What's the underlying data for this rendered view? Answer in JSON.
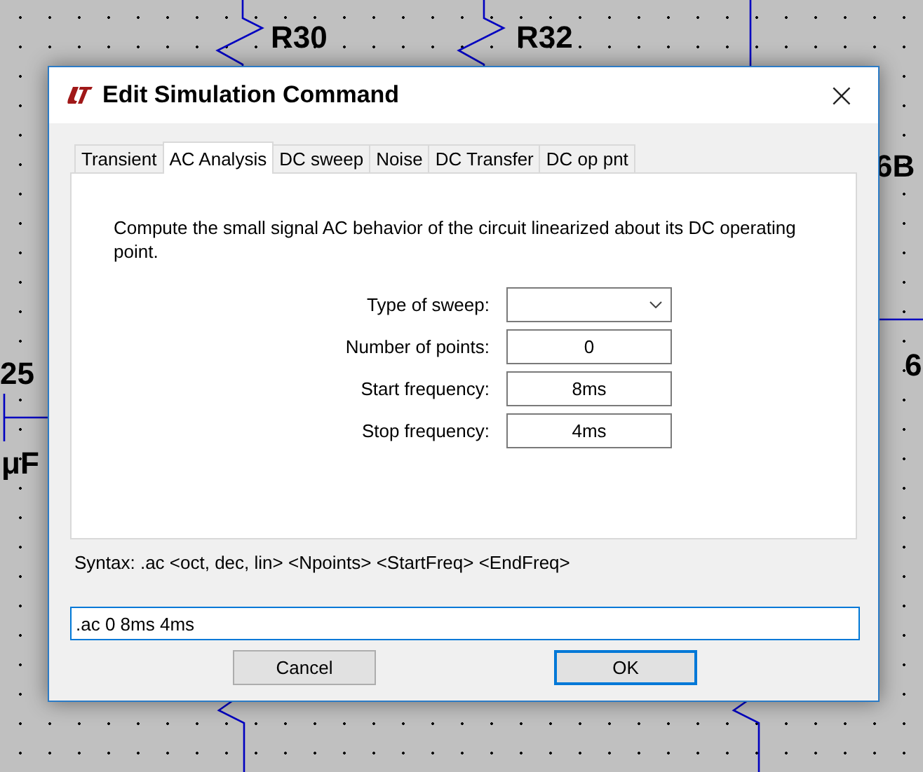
{
  "schematic": {
    "labels": [
      "R30",
      "R32",
      "6B",
      "6",
      "25",
      "μF"
    ]
  },
  "dialog": {
    "title": "Edit Simulation Command",
    "close": "×",
    "tabs": [
      {
        "label": "Transient",
        "selected": false
      },
      {
        "label": "AC Analysis",
        "selected": true
      },
      {
        "label": "DC sweep",
        "selected": false
      },
      {
        "label": "Noise",
        "selected": false
      },
      {
        "label": "DC Transfer",
        "selected": false
      },
      {
        "label": "DC op pnt",
        "selected": false
      }
    ],
    "description": "Compute the small signal AC behavior of the circuit linearized about its DC operating point.",
    "fields": [
      {
        "label": "Type of sweep:",
        "kind": "dropdown"
      },
      {
        "label": "Number of points:",
        "kind": "text",
        "value": "0"
      },
      {
        "label": "Start frequency:",
        "kind": "text",
        "value": "8ms"
      },
      {
        "label": "Stop frequency:",
        "kind": "text",
        "value": "4ms"
      }
    ],
    "syntax": "Syntax:  .ac <oct, dec, lin> <Npoints> <StartFreq> <EndFreq>",
    "command": {
      "value": ".ac 0 8ms 4ms",
      "focused": true
    },
    "buttons": [
      {
        "label": "Cancel",
        "default": false
      },
      {
        "label": "OK",
        "default": true
      }
    ]
  }
}
